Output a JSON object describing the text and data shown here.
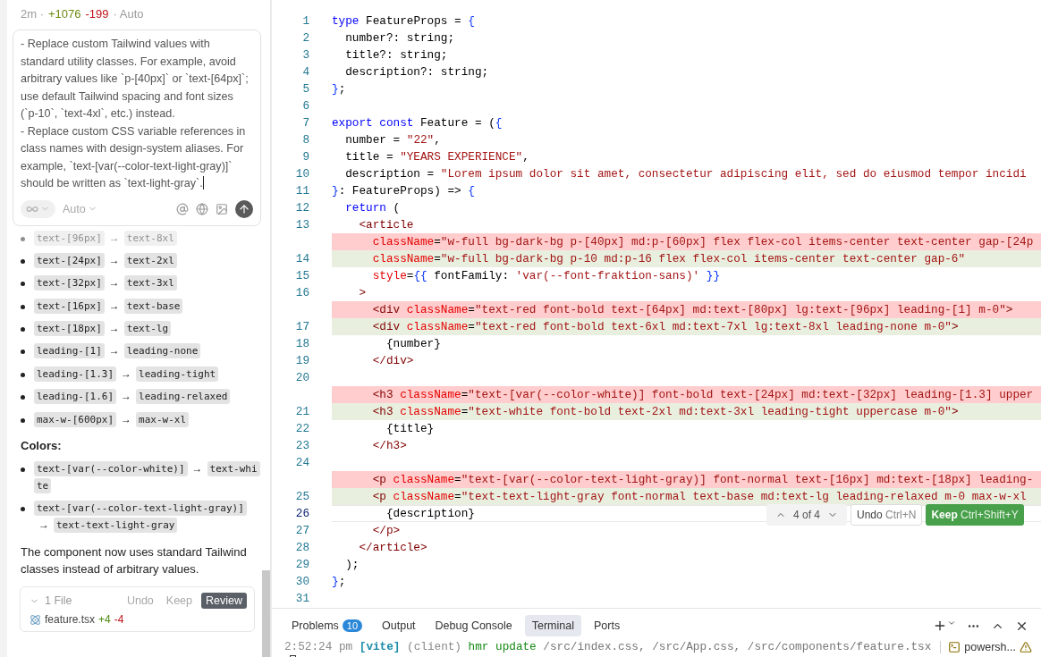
{
  "chat": {
    "meta": [
      {
        "kind": "muted",
        "text": "2m ·"
      },
      {
        "kind": "added",
        "text": "+1076"
      },
      {
        "kind": "removed",
        "text": "-199"
      },
      {
        "kind": "muted",
        "text": "· Auto"
      }
    ],
    "prompt": {
      "value": "- Replace custom Tailwind values with standard utility classes. For example, avoid arbitrary values like `p-[40px]` or `text-[64px]`; use default Tailwind spacing and font sizes (`p-10`, `text-4xl`, etc.) instead.\n- Replace custom CSS variable references in class names with design-system aliases. For example, `text-[var(--color-text-light-gray)]` should be written as `text-light-gray`.",
      "mode": "Auto"
    },
    "mappings": [
      {
        "from": "text-[96px]",
        "arrow": "→",
        "to": "text-8xl",
        "faded": true
      },
      {
        "from": "text-[24px]",
        "arrow": "→",
        "to": "text-2xl",
        "faded": false
      },
      {
        "from": "text-[32px]",
        "arrow": "→",
        "to": "text-3xl",
        "faded": false
      },
      {
        "from": "text-[16px]",
        "arrow": "→",
        "to": "text-base",
        "faded": false
      },
      {
        "from": "text-[18px]",
        "arrow": "→",
        "to": "text-lg",
        "faded": false
      },
      {
        "from": "leading-[1]",
        "arrow": "→",
        "to": "leading-none",
        "faded": false
      },
      {
        "from": "leading-[1.3]",
        "arrow": "→",
        "to": "leading-tight",
        "faded": false
      },
      {
        "from": "leading-[1.6]",
        "arrow": "→",
        "to": "leading-relaxed",
        "faded": false
      },
      {
        "from": "max-w-[600px]",
        "arrow": "→",
        "to": "max-w-xl",
        "faded": false
      }
    ],
    "colors_heading": "Colors:",
    "color_mappings": [
      {
        "from": "text-[var(--color-white)]",
        "arrow": "→",
        "to": "text-white"
      },
      {
        "from": "text-[var(--color-text-light-gray)]",
        "arrow": "→",
        "to": "text-text-light-gray"
      }
    ],
    "summary": "The component now uses standard Tailwind classes instead of arbitrary values.",
    "changes": {
      "count": "1 File",
      "undo": "Undo",
      "keep": "Keep",
      "review": "Review",
      "files": [
        {
          "name": "feature.tsx",
          "added": "+4",
          "removed": "-4"
        }
      ]
    }
  },
  "editor": {
    "lines": [
      {
        "kind": "normal",
        "number": "1",
        "current": false,
        "tokens": [
          {
            "kind": "kw",
            "text": "type"
          },
          {
            "kind": "plain",
            "text": " FeatureProps = "
          },
          {
            "kind": "brace",
            "text": "{"
          }
        ]
      },
      {
        "kind": "normal",
        "number": "2",
        "current": false,
        "tokens": [
          {
            "kind": "plain",
            "text": "  number?: string;"
          }
        ]
      },
      {
        "kind": "normal",
        "number": "3",
        "current": false,
        "tokens": [
          {
            "kind": "plain",
            "text": "  title?: string;"
          }
        ]
      },
      {
        "kind": "normal",
        "number": "4",
        "current": false,
        "tokens": [
          {
            "kind": "plain",
            "text": "  description?: string;"
          }
        ]
      },
      {
        "kind": "normal",
        "number": "5",
        "current": false,
        "tokens": [
          {
            "kind": "brace",
            "text": "}"
          },
          {
            "kind": "plain",
            "text": ";"
          }
        ]
      },
      {
        "kind": "normal",
        "number": "6",
        "current": false
      },
      {
        "kind": "normal",
        "number": "7",
        "current": false,
        "tokens": [
          {
            "kind": "kw",
            "text": "export "
          },
          {
            "kind": "kw",
            "text": "const"
          },
          {
            "kind": "plain",
            "text": " Feature = ("
          },
          {
            "kind": "brace",
            "text": "{"
          }
        ]
      },
      {
        "kind": "normal",
        "number": "8",
        "current": false,
        "tokens": [
          {
            "kind": "plain",
            "text": "  number = "
          },
          {
            "kind": "str",
            "text": "\"22\""
          },
          {
            "kind": "plain",
            "text": ","
          }
        ]
      },
      {
        "kind": "normal",
        "number": "9",
        "current": false,
        "tokens": [
          {
            "kind": "plain",
            "text": "  title = "
          },
          {
            "kind": "str",
            "text": "\"YEARS EXPERIENCE\""
          },
          {
            "kind": "plain",
            "text": ","
          }
        ]
      },
      {
        "kind": "normal",
        "number": "10",
        "current": false,
        "tokens": [
          {
            "kind": "plain",
            "text": "  description = "
          },
          {
            "kind": "str",
            "text": "\"Lorem ipsum dolor sit amet, consectetur adipiscing elit, sed do eiusmod tempor incidi"
          }
        ]
      },
      {
        "kind": "normal",
        "number": "11",
        "current": false,
        "tokens": [
          {
            "kind": "brace",
            "text": "}"
          },
          {
            "kind": "plain",
            "text": ": FeatureProps) => "
          },
          {
            "kind": "brace",
            "text": "{"
          }
        ]
      },
      {
        "kind": "normal",
        "number": "12",
        "current": false,
        "tokens": [
          {
            "kind": "kw",
            "text": "  return"
          },
          {
            "kind": "plain",
            "text": " ("
          }
        ]
      },
      {
        "kind": "normal",
        "number": "13",
        "current": false,
        "tokens": [
          {
            "kind": "tag",
            "text": "    <article"
          }
        ]
      },
      {
        "kind": "deleted",
        "current": false,
        "tokens": [
          {
            "kind": "attr",
            "text": "      className"
          },
          {
            "kind": "plain",
            "text": "="
          },
          {
            "kind": "str",
            "text": "\"w-full bg-dark-bg p-[40px] md:p-[60px] flex flex-col items-center text-center gap-[24p"
          }
        ]
      },
      {
        "kind": "added",
        "number": "14",
        "current": false,
        "tokens": [
          {
            "kind": "attr",
            "text": "      className"
          },
          {
            "kind": "plain",
            "text": "="
          },
          {
            "kind": "str",
            "text": "\"w-full bg-dark-bg p-10 md:p-16 flex flex-col items-center text-center gap-6\""
          }
        ]
      },
      {
        "kind": "normal",
        "number": "15",
        "current": false,
        "tokens": [
          {
            "kind": "attr",
            "text": "      style"
          },
          {
            "kind": "plain",
            "text": "="
          },
          {
            "kind": "brace",
            "text": "{{"
          },
          {
            "kind": "plain",
            "text": " fontFamily: "
          },
          {
            "kind": "str",
            "text": "'var(--font-fraktion-sans)'"
          },
          {
            "kind": "brace",
            "text": " }}"
          }
        ]
      },
      {
        "kind": "normal",
        "number": "16",
        "current": false,
        "tokens": [
          {
            "kind": "tag",
            "text": "    >"
          }
        ]
      },
      {
        "kind": "deleted",
        "current": false,
        "tokens": [
          {
            "kind": "tag",
            "text": "      <div"
          },
          {
            "kind": "attr",
            "text": " className"
          },
          {
            "kind": "plain",
            "text": "="
          },
          {
            "kind": "str",
            "text": "\"text-red font-bold text-[64px] md:text-[80px] lg:text-[96px] leading-[1] m-0\""
          },
          {
            "kind": "tag",
            "text": ">"
          }
        ]
      },
      {
        "kind": "added",
        "number": "17",
        "current": false,
        "tokens": [
          {
            "kind": "tag",
            "text": "      <div"
          },
          {
            "kind": "attr",
            "text": " className"
          },
          {
            "kind": "plain",
            "text": "="
          },
          {
            "kind": "str",
            "text": "\"text-red font-bold text-6xl md:text-7xl lg:text-8xl leading-none m-0\""
          },
          {
            "kind": "tag",
            "text": ">"
          }
        ]
      },
      {
        "kind": "normal",
        "number": "18",
        "current": false,
        "tokens": [
          {
            "kind": "plain",
            "text": "        {number}"
          }
        ]
      },
      {
        "kind": "normal",
        "number": "19",
        "current": false,
        "tokens": [
          {
            "kind": "tag",
            "text": "      </div>"
          }
        ]
      },
      {
        "kind": "normal",
        "number": "20",
        "current": false
      },
      {
        "kind": "deleted",
        "current": false,
        "tokens": [
          {
            "kind": "tag",
            "text": "      <h3"
          },
          {
            "kind": "attr",
            "text": " className"
          },
          {
            "kind": "plain",
            "text": "="
          },
          {
            "kind": "str",
            "text": "\"text-[var(--color-white)] font-bold text-[24px] md:text-[32px] leading-[1.3] upper"
          }
        ]
      },
      {
        "kind": "added",
        "number": "21",
        "current": false,
        "tokens": [
          {
            "kind": "tag",
            "text": "      <h3"
          },
          {
            "kind": "attr",
            "text": " className"
          },
          {
            "kind": "plain",
            "text": "="
          },
          {
            "kind": "str",
            "text": "\"text-white font-bold text-2xl md:text-3xl leading-tight uppercase m-0\""
          },
          {
            "kind": "tag",
            "text": ">"
          }
        ]
      },
      {
        "kind": "normal",
        "number": "22",
        "current": false,
        "tokens": [
          {
            "kind": "plain",
            "text": "        {title}"
          }
        ]
      },
      {
        "kind": "normal",
        "number": "23",
        "current": false,
        "tokens": [
          {
            "kind": "tag",
            "text": "      </h3>"
          }
        ]
      },
      {
        "kind": "normal",
        "number": "24",
        "current": false
      },
      {
        "kind": "deleted",
        "current": false,
        "tokens": [
          {
            "kind": "tag",
            "text": "      <p"
          },
          {
            "kind": "attr",
            "text": " className"
          },
          {
            "kind": "plain",
            "text": "="
          },
          {
            "kind": "str",
            "text": "\"text-[var(--color-text-light-gray)] font-normal text-[16px] md:text-[18px] leading-"
          }
        ]
      },
      {
        "kind": "added",
        "number": "25",
        "current": false,
        "tokens": [
          {
            "kind": "tag",
            "text": "      <p"
          },
          {
            "kind": "attr",
            "text": " className"
          },
          {
            "kind": "plain",
            "text": "="
          },
          {
            "kind": "str",
            "text": "\"text-text-light-gray font-normal text-base md:text-lg leading-relaxed m-0 max-w-xl"
          }
        ]
      },
      {
        "kind": "normal",
        "number": "26",
        "current": true,
        "tokens": [
          {
            "kind": "plain",
            "text": "        {description}"
          }
        ]
      },
      {
        "kind": "normal",
        "number": "27",
        "current": false,
        "tokens": [
          {
            "kind": "tag",
            "text": "      </p>"
          }
        ]
      },
      {
        "kind": "normal",
        "number": "28",
        "current": false,
        "tokens": [
          {
            "kind": "tag",
            "text": "    </article>"
          }
        ]
      },
      {
        "kind": "normal",
        "number": "29",
        "current": false,
        "tokens": [
          {
            "kind": "plain",
            "text": "  );"
          }
        ]
      },
      {
        "kind": "normal",
        "number": "30",
        "current": false,
        "tokens": [
          {
            "kind": "brace",
            "text": "}"
          },
          {
            "kind": "plain",
            "text": ";"
          }
        ]
      },
      {
        "kind": "normal",
        "number": "31",
        "current": false
      }
    ],
    "review_widget": {
      "position": "4 of 4",
      "undo": "Undo",
      "undo_key": "Ctrl+N",
      "keep": "Keep",
      "keep_key": "Ctrl+Shift+Y"
    }
  },
  "panel": {
    "tabs": [
      {
        "label": "Problems",
        "badge": "10",
        "selected": false
      },
      {
        "label": "Output",
        "selected": false
      },
      {
        "label": "Debug Console",
        "selected": false
      },
      {
        "label": "Terminal",
        "selected": true
      },
      {
        "label": "Ports",
        "selected": false
      }
    ],
    "terminal_line": [
      {
        "kind": "time",
        "text": "2:52:24 pm "
      },
      {
        "kind": "vite",
        "text": "[vite]"
      },
      {
        "kind": "client",
        "text": " (client) "
      },
      {
        "kind": "cmd",
        "text": "hmr update "
      },
      {
        "kind": "path",
        "text": "/src/index.css, /src/App.css, /src/components/feature.tsx"
      }
    ],
    "terminal_instance": "powersh..."
  }
}
